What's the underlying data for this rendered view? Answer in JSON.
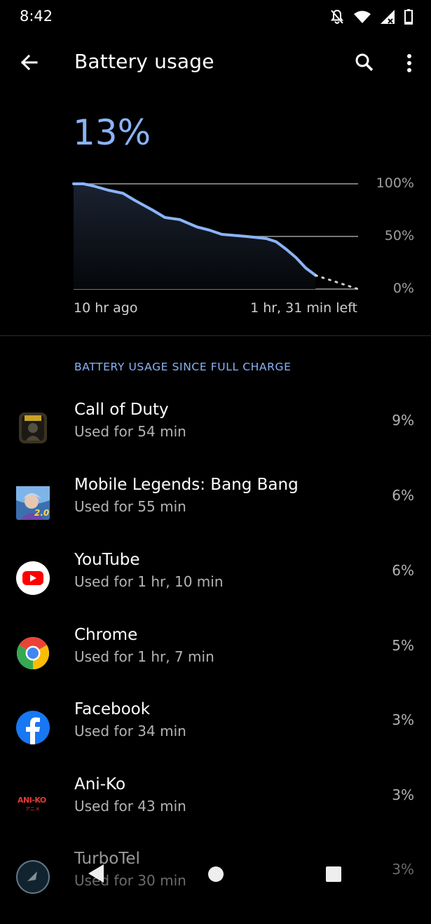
{
  "status_bar": {
    "time": "8:42",
    "icons": [
      "notifications-off-icon",
      "wifi-icon",
      "signal-icon",
      "battery-icon"
    ]
  },
  "app_bar": {
    "title": "Battery usage",
    "back_icon": "arrow-back-icon",
    "search_icon": "search-icon",
    "menu_icon": "more-vert-icon"
  },
  "summary": {
    "percent": "13%",
    "time_start": "10 hr ago",
    "time_left": "1 hr, 31 min left"
  },
  "chart_data": {
    "type": "area",
    "yticks": [
      "100%",
      "50%",
      "0%"
    ],
    "ylim": [
      0,
      100
    ],
    "xlim": [
      0,
      11.52
    ],
    "x_start_label": "10 hr ago",
    "x_end_label": "1 hr, 31 min left",
    "history": {
      "x": [
        0,
        0.4,
        0.8,
        1.4,
        2.0,
        2.5,
        3.2,
        3.7,
        4.3,
        5.0,
        5.5,
        6.0,
        6.5,
        7.0,
        7.4,
        7.8,
        8.2,
        8.6,
        9.0,
        9.4,
        9.8
      ],
      "y": [
        100,
        100,
        98,
        94,
        91,
        84,
        75,
        68,
        66,
        59,
        56,
        52,
        51,
        50,
        49,
        48,
        45,
        38,
        30,
        20,
        13
      ]
    },
    "projection": {
      "x": [
        9.8,
        11.52
      ],
      "y": [
        13,
        0
      ]
    },
    "colors": {
      "line": "#8ab4f8",
      "fill_top": "#1a2230",
      "fill_bottom": "#05070a",
      "grid": "#9e9e9e"
    }
  },
  "section_header": "BATTERY USAGE SINCE FULL CHARGE",
  "apps": [
    {
      "name": "Call of Duty",
      "usage": "Used for 54 min",
      "percent": "9%",
      "icon": "call-of-duty-icon"
    },
    {
      "name": "Mobile Legends: Bang Bang",
      "usage": "Used for 55 min",
      "percent": "6%",
      "icon": "mobile-legends-icon",
      "icon_badge": "2.0"
    },
    {
      "name": "YouTube",
      "usage": "Used for 1 hr, 10 min",
      "percent": "6%",
      "icon": "youtube-icon"
    },
    {
      "name": "Chrome",
      "usage": "Used for 1 hr, 7 min",
      "percent": "5%",
      "icon": "chrome-icon"
    },
    {
      "name": "Facebook",
      "usage": "Used for 34 min",
      "percent": "3%",
      "icon": "facebook-icon"
    },
    {
      "name": "Ani-Ko",
      "usage": "Used for 43 min",
      "percent": "3%",
      "icon": "ani-ko-icon",
      "icon_text": "ANI-KO",
      "icon_subtext": "アニメ"
    },
    {
      "name": "TurboTel",
      "usage": "Used for 30 min",
      "percent": "3%",
      "icon": "turbotel-icon"
    }
  ],
  "nav_bar": {
    "back": "nav-back-icon",
    "home": "nav-home-icon",
    "recents": "nav-recents-icon"
  }
}
